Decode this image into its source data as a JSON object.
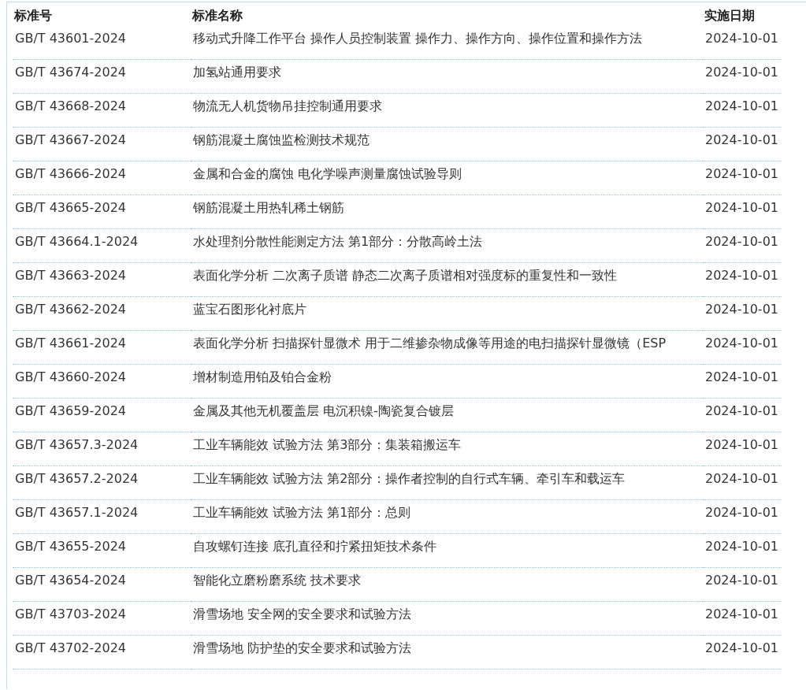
{
  "table": {
    "columns": [
      "标准号",
      "标准名称",
      "实施日期"
    ],
    "rows": [
      {
        "code": "GB/T 43601-2024",
        "name": "移动式升降工作平台 操作人员控制装置 操作力、操作方向、操作位置和操作方法",
        "date": "2024-10-01"
      },
      {
        "code": "GB/T 43674-2024",
        "name": "加氢站通用要求",
        "date": "2024-10-01"
      },
      {
        "code": "GB/T 43668-2024",
        "name": "物流无人机货物吊挂控制通用要求",
        "date": "2024-10-01"
      },
      {
        "code": "GB/T 43667-2024",
        "name": "钢筋混凝土腐蚀监检测技术规范",
        "date": "2024-10-01"
      },
      {
        "code": "GB/T 43666-2024",
        "name": "金属和合金的腐蚀 电化学噪声测量腐蚀试验导则",
        "date": "2024-10-01"
      },
      {
        "code": "GB/T 43665-2024",
        "name": "钢筋混凝土用热轧稀土钢筋",
        "date": "2024-10-01"
      },
      {
        "code": "GB/T 43664.1-2024",
        "name": "水处理剂分散性能测定方法 第1部分：分散高岭土法",
        "date": "2024-10-01"
      },
      {
        "code": "GB/T 43663-2024",
        "name": "表面化学分析 二次离子质谱 静态二次离子质谱相对强度标的重复性和一致性",
        "date": "2024-10-01"
      },
      {
        "code": "GB/T 43662-2024",
        "name": "蓝宝石图形化衬底片",
        "date": "2024-10-01"
      },
      {
        "code": "GB/T 43661-2024",
        "name": "表面化学分析 扫描探针显微术 用于二维掺杂物成像等用途的电扫描探针显微镜（ESP",
        "date": "2024-10-01"
      },
      {
        "code": "GB/T 43660-2024",
        "name": "增材制造用铂及铂合金粉",
        "date": "2024-10-01"
      },
      {
        "code": "GB/T 43659-2024",
        "name": "金属及其他无机覆盖层 电沉积镍-陶瓷复合镀层",
        "date": "2024-10-01"
      },
      {
        "code": "GB/T 43657.3-2024",
        "name": "工业车辆能效 试验方法 第3部分：集装箱搬运车",
        "date": "2024-10-01"
      },
      {
        "code": "GB/T 43657.2-2024",
        "name": "工业车辆能效 试验方法 第2部分：操作者控制的自行式车辆、牵引车和载运车",
        "date": "2024-10-01"
      },
      {
        "code": "GB/T 43657.1-2024",
        "name": "工业车辆能效 试验方法 第1部分：总则",
        "date": "2024-10-01"
      },
      {
        "code": "GB/T 43655-2024",
        "name": "自攻螺钉连接 底孔直径和拧紧扭矩技术条件",
        "date": "2024-10-01"
      },
      {
        "code": "GB/T 43654-2024",
        "name": "智能化立磨粉磨系统 技术要求",
        "date": "2024-10-01"
      },
      {
        "code": "GB/T 43703-2024",
        "name": "滑雪场地 安全网的安全要求和试验方法",
        "date": "2024-10-01"
      },
      {
        "code": "GB/T 43702-2024",
        "name": "滑雪场地 防护垫的安全要求和试验方法",
        "date": "2024-10-01"
      }
    ]
  }
}
